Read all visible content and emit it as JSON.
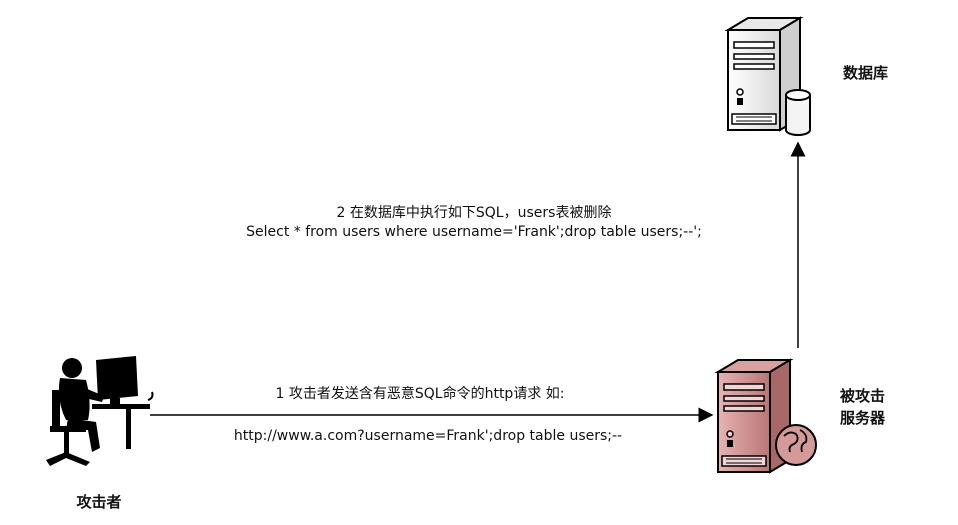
{
  "nodes": {
    "attacker": {
      "label": "攻击者"
    },
    "web_server": {
      "label_line1": "被攻击",
      "label_line2": "服务器"
    },
    "database": {
      "label": "数据库"
    }
  },
  "steps": {
    "step1": {
      "line1": "1 攻击者发送含有恶意SQL命令的http请求 如:",
      "line2": "http://www.a.com?username=Frank';drop table users;--"
    },
    "step2": {
      "line1": "2 在数据库中执行如下SQL，users表被删除",
      "line2": "Select * from users where username='Frank';drop table users;--';"
    }
  },
  "colors": {
    "arrow": "#000000",
    "web_server": "#c98a8a",
    "database_server": "#f2f2f2"
  }
}
